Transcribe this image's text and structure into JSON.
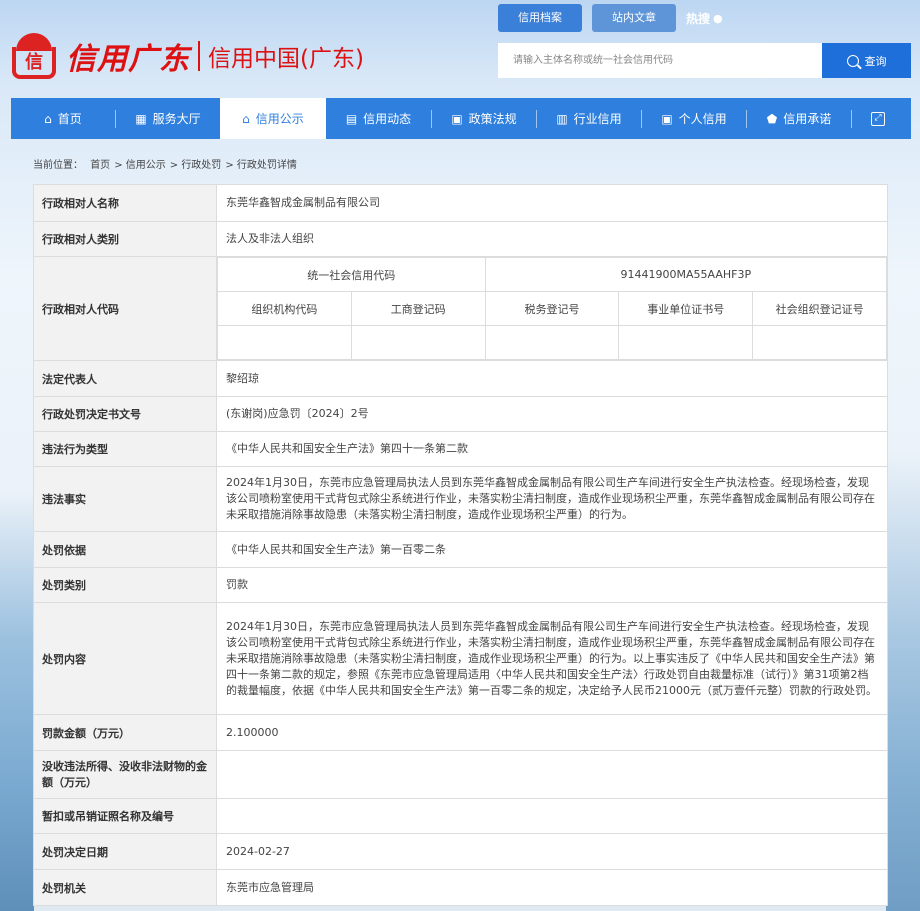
{
  "header": {
    "logo_char": "信",
    "logo_script": "信用广东",
    "logo_sub": "信用中国(广东)",
    "top_tabs": [
      "信用档案",
      "站内文章"
    ],
    "hot_label": "热搜",
    "search_placeholder": "请输入主体名称或统一社会信用代码",
    "search_button": "查询"
  },
  "nav": {
    "items": [
      {
        "label": "首页",
        "icon": "home-icon",
        "glyph": "⌂"
      },
      {
        "label": "服务大厅",
        "icon": "grid-icon",
        "glyph": "▦"
      },
      {
        "label": "信用公示",
        "icon": "announce-icon",
        "glyph": "⌂"
      },
      {
        "label": "信用动态",
        "icon": "news-icon",
        "glyph": "▤"
      },
      {
        "label": "政策法规",
        "icon": "book-icon",
        "glyph": "▣"
      },
      {
        "label": "行业信用",
        "icon": "building-icon",
        "glyph": "▥"
      },
      {
        "label": "个人信用",
        "icon": "person-icon",
        "glyph": "▣"
      },
      {
        "label": "信用承诺",
        "icon": "shield-icon",
        "glyph": "⬟"
      }
    ],
    "active_index": 2,
    "expand_icon": "expand-icon"
  },
  "breadcrumb": {
    "prefix": "当前位置：",
    "items": [
      "首页",
      "信用公示",
      "行政处罚",
      "行政处罚详情"
    ]
  },
  "detail": {
    "name_label": "行政相对人名称",
    "name_value": "东莞华鑫智成金属制品有限公司",
    "type_label": "行政相对人类别",
    "type_value": "法人及非法人组织",
    "code_label": "行政相对人代码",
    "uscc_label": "统一社会信用代码",
    "uscc_value": "91441900MA55AAHF3P",
    "sub_headers": [
      "组织机构代码",
      "工商登记码",
      "税务登记号",
      "事业单位证书号",
      "社会组织登记证号"
    ],
    "sub_values": [
      "",
      "",
      "",
      "",
      ""
    ],
    "rep_label": "法定代表人",
    "rep_value": "黎绍琼",
    "doc_label": "行政处罚决定书文号",
    "doc_value": "(东谢岗)应急罚〔2024〕2号",
    "violation_type_label": "违法行为类型",
    "violation_type_value": "《中华人民共和国安全生产法》第四十一条第二款",
    "facts_label": "违法事实",
    "facts_value": "2024年1月30日，东莞市应急管理局执法人员到东莞华鑫智成金属制品有限公司生产车间进行安全生产执法检查。经现场检查，发现该公司喷粉室使用干式背包式除尘系统进行作业，未落实粉尘清扫制度，造成作业现场积尘严重，东莞华鑫智成金属制品有限公司存在未采取措施消除事故隐患（未落实粉尘清扫制度，造成作业现场积尘严重）的行为。",
    "basis_label": "处罚依据",
    "basis_value": "《中华人民共和国安全生产法》第一百零二条",
    "category_label": "处罚类别",
    "category_value": "罚款",
    "content_label": "处罚内容",
    "content_value": "2024年1月30日，东莞市应急管理局执法人员到东莞华鑫智成金属制品有限公司生产车间进行安全生产执法检查。经现场检查，发现该公司喷粉室使用干式背包式除尘系统进行作业，未落实粉尘清扫制度，造成作业现场积尘严重，东莞华鑫智成金属制品有限公司存在未采取措施消除事故隐患（未落实粉尘清扫制度，造成作业现场积尘严重）的行为。以上事实违反了《中华人民共和国安全生产法》第四十一条第二款的规定，参照《东莞市应急管理局适用〈中华人民共和国安全生产法〉行政处罚自由裁量标准（试行）》第31项第2档的裁量幅度，依据《中华人民共和国安全生产法》第一百零二条的规定，决定给予人民币21000元（贰万壹仟元整）罚款的行政处罚。",
    "fine_label": "罚款金额（万元）",
    "fine_value": "2.100000",
    "confiscate_label": "没收违法所得、没收非法财物的金额（万元）",
    "confiscate_value": "",
    "license_label": "暂扣或吊销证照名称及编号",
    "license_value": "",
    "date_label": "处罚决定日期",
    "date_value": "2024-02-27",
    "authority_label": "处罚机关",
    "authority_value": "东莞市应急管理局"
  }
}
